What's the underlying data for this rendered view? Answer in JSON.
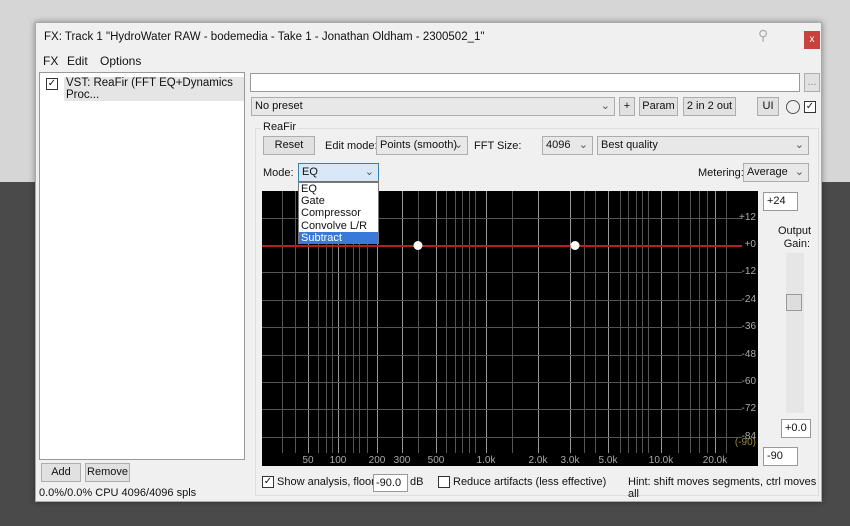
{
  "window": {
    "title": "FX: Track 1 \"HydroWater RAW - bodemedia - Take 1 - Jonathan Oldham - 2300502_1\"",
    "close": "x"
  },
  "menu": [
    "FX",
    "Edit",
    "Options"
  ],
  "fx_list": {
    "items": [
      {
        "label": "VST: ReaFir (FFT EQ+Dynamics Proc...",
        "checked": true
      }
    ],
    "add": "Add",
    "remove": "Remove",
    "cpu": "0.0%/0.0% CPU 4096/4096 spls"
  },
  "toolbar": {
    "name_value": "",
    "more": "...",
    "preset": "No preset",
    "plus": "+",
    "param": "Param",
    "io": "2 in 2 out",
    "ui": "UI"
  },
  "plugin": {
    "group": "ReaFir",
    "reset": "Reset",
    "edit_mode_label": "Edit mode:",
    "edit_mode": "Points (smooth)",
    "fft_label": "FFT Size:",
    "fft": "4096",
    "quality": "Best quality",
    "mode_label": "Mode:",
    "mode": "EQ",
    "metering_label": "Metering:",
    "metering": "Average",
    "mode_options": [
      "EQ",
      "Gate",
      "Compressor",
      "Convolve L/R",
      "Subtract"
    ],
    "mode_highlighted": "Subtract"
  },
  "graph": {
    "y_labels": [
      "+12",
      "+0",
      "-12",
      "-24",
      "-36",
      "-48",
      "-60",
      "-72",
      "-84",
      "(-90)"
    ],
    "x_labels": [
      "50",
      "100",
      "200",
      "300",
      "500",
      "1.0k",
      "2.0k",
      "3.0k",
      "5.0k",
      "10.0k",
      "20.0k"
    ],
    "curve_db": 0,
    "curve_color": "#b42020"
  },
  "gain": {
    "top": "+24",
    "label": "Output Gain:",
    "value": "+0.0",
    "bottom": "-90",
    "slider_db": 0
  },
  "bottom": {
    "show_analysis": "Show analysis, floor:",
    "show_analysis_checked": true,
    "floor": "-90.0",
    "db": "dB",
    "reduce": "Reduce artifacts (less effective)",
    "reduce_checked": false,
    "hint": "Hint: shift moves segments, ctrl moves all"
  }
}
